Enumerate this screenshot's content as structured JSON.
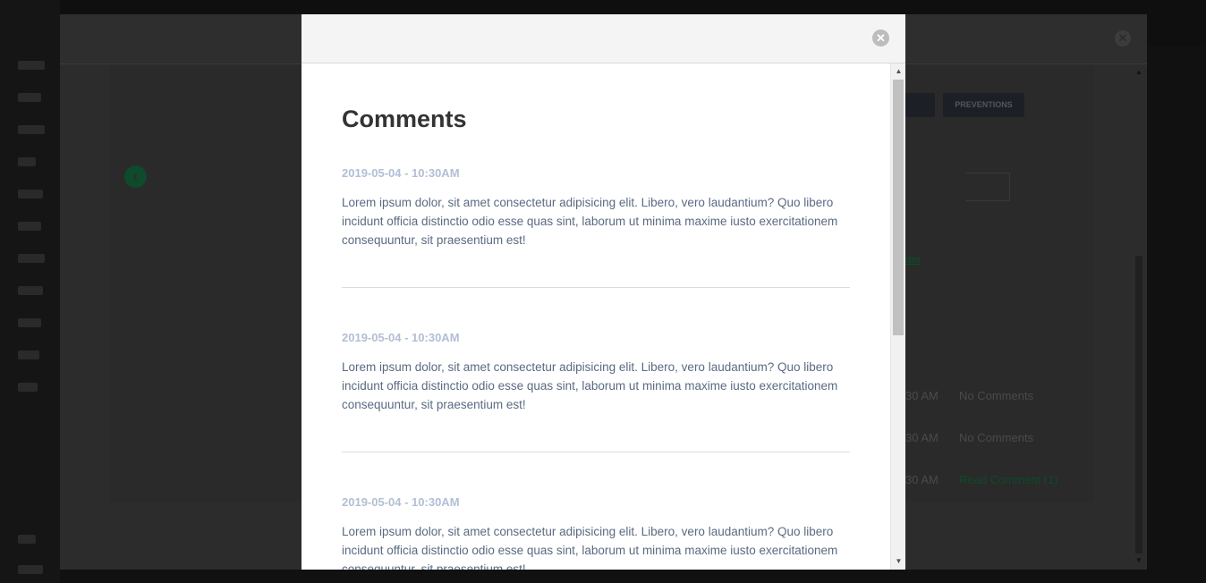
{
  "background": {
    "buttons": [
      {
        "label": "PREVENTIONS"
      }
    ],
    "table": [
      {
        "time": "30 AM",
        "comments": "No Comments"
      },
      {
        "time": "30 AM",
        "comments": "No Comments"
      },
      {
        "time": "30 AM",
        "comments": "Read Comment (1)"
      }
    ],
    "link_fragment": "der"
  },
  "modal": {
    "close_symbol": "✕",
    "title": "Comments",
    "comments": [
      {
        "date": "2019-05-04 - 10:30AM",
        "text": "Lorem ipsum dolor, sit amet consectetur adipisicing elit. Libero, vero laudantium? Quo libero incidunt officia distinctio odio esse quas sint, laborum ut minima maxime iusto exercitationem consequuntur, sit praesentium est!"
      },
      {
        "date": "2019-05-04 - 10:30AM",
        "text": "Lorem ipsum dolor, sit amet consectetur adipisicing elit. Libero, vero laudantium? Quo libero incidunt officia distinctio odio esse quas sint, laborum ut minima maxime iusto exercitationem consequuntur, sit praesentium est!"
      },
      {
        "date": "2019-05-04 - 10:30AM",
        "text": "Lorem ipsum dolor, sit amet consectetur adipisicing elit. Libero, vero laudantium? Quo libero incidunt officia distinctio odio esse quas sint, laborum ut minima maxime iusto exercitationem consequuntur, sit praesentium est!"
      }
    ]
  },
  "colors": {
    "accent_green": "#0e4a2b",
    "date_color": "#b2bfd4",
    "text_color": "#5a6a82"
  }
}
